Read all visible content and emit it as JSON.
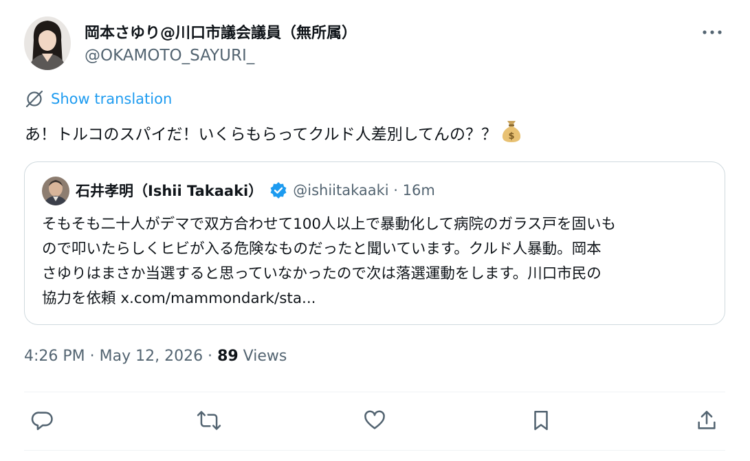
{
  "author": {
    "display_name": "岡本さゆり@川口市議会議員（無所属）",
    "handle": "@OKAMOTO_SAYURI_",
    "avatar_icon": "avatar-photo"
  },
  "menu": {
    "more_icon": "more-horizontal-icon"
  },
  "translation": {
    "label": "Show translation",
    "icon": "translate-globe-icon"
  },
  "tweet": {
    "text": "あ！トルコのスパイだ！いくらもらってクルド人差別してんの？？",
    "emoji_icon": "money-bag-icon"
  },
  "quote": {
    "author_name": "石井孝明（Ishii Takaaki）",
    "verified_icon": "verified-badge-icon",
    "handle_time": "@ishiitakaaki · 16m",
    "lines": [
      "そもそも二十人がデマで双方合わせて100人以上で暴動化して病院のガラス戸を固いも",
      "ので叩いたらしくヒビが入る危険なものだったと聞いています。クルド人暴動。岡本",
      "さゆりはまさか当選すると思っていなかったので次は落選運動をします。川口市民の",
      "協力を依頼 x.com/mammondark/sta..."
    ]
  },
  "meta": {
    "timestamp": "4:26 PM · May 12, 2026 · ",
    "views_count": "89",
    "views_label": " Views"
  },
  "actions": [
    "reply-icon",
    "retweet-icon",
    "like-icon",
    "bookmark-icon",
    "share-icon"
  ],
  "colors": {
    "accent": "#1d9bf0",
    "text_primary": "#0f1419",
    "text_secondary": "#536471",
    "border": "#cfd9de"
  }
}
